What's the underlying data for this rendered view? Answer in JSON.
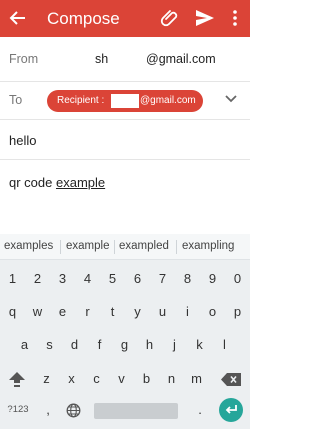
{
  "appbar": {
    "title": "Compose"
  },
  "from": {
    "label": "From",
    "user": "sh",
    "domain": "@gmail.com"
  },
  "to": {
    "label": "To",
    "chip_prefix": "Recipient :",
    "chip_domain": "@gmail.com"
  },
  "subject": {
    "value": "hello"
  },
  "body": {
    "text": "qr code ",
    "underlined": "example"
  },
  "suggestions": [
    "examples",
    "example",
    "exampled",
    "exampling"
  ],
  "keyboard": {
    "numbers": [
      "1",
      "2",
      "3",
      "4",
      "5",
      "6",
      "7",
      "8",
      "9",
      "0"
    ],
    "row1": [
      "q",
      "w",
      "e",
      "r",
      "t",
      "y",
      "u",
      "i",
      "o",
      "p"
    ],
    "row2": [
      "a",
      "s",
      "d",
      "f",
      "g",
      "h",
      "j",
      "k",
      "l"
    ],
    "row3": [
      "z",
      "x",
      "c",
      "v",
      "b",
      "n",
      "m"
    ],
    "symbols_label": "?123",
    "comma": ",",
    "period": "."
  },
  "colors": {
    "accent": "#db4437",
    "enter": "#26a69a"
  }
}
